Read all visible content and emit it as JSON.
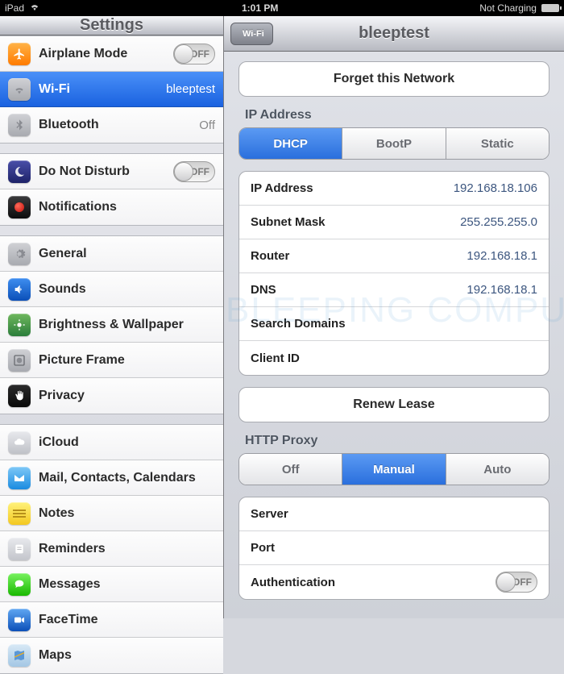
{
  "status": {
    "device": "iPad",
    "time": "1:01 PM",
    "charge": "Not Charging"
  },
  "sidebar": {
    "title": "Settings",
    "groups": [
      [
        {
          "label": "Airplane Mode",
          "toggle": "OFF"
        },
        {
          "label": "Wi-Fi",
          "value": "bleeptest",
          "selected": true
        },
        {
          "label": "Bluetooth",
          "value": "Off"
        }
      ],
      [
        {
          "label": "Do Not Disturb",
          "toggle": "OFF"
        },
        {
          "label": "Notifications"
        }
      ],
      [
        {
          "label": "General"
        },
        {
          "label": "Sounds"
        },
        {
          "label": "Brightness & Wallpaper"
        },
        {
          "label": "Picture Frame"
        },
        {
          "label": "Privacy"
        }
      ],
      [
        {
          "label": "iCloud"
        },
        {
          "label": "Mail, Contacts, Calendars"
        },
        {
          "label": "Notes"
        },
        {
          "label": "Reminders"
        },
        {
          "label": "Messages"
        },
        {
          "label": "FaceTime"
        },
        {
          "label": "Maps"
        }
      ]
    ]
  },
  "detail": {
    "back": "Wi-Fi",
    "title": "bleeptest",
    "forget": "Forget this Network",
    "ip_section": "IP Address",
    "ip_seg": {
      "dhcp": "DHCP",
      "bootp": "BootP",
      "static": "Static"
    },
    "fields": {
      "ip_label": "IP Address",
      "ip_value": "192.168.18.106",
      "mask_label": "Subnet Mask",
      "mask_value": "255.255.255.0",
      "router_label": "Router",
      "router_value": "192.168.18.1",
      "dns_label": "DNS",
      "dns_value": "192.168.18.1",
      "search_label": "Search Domains",
      "client_label": "Client ID"
    },
    "renew": "Renew Lease",
    "proxy_section": "HTTP Proxy",
    "proxy_seg": {
      "off": "Off",
      "manual": "Manual",
      "auto": "Auto"
    },
    "proxy_fields": {
      "server": "Server",
      "port": "Port",
      "auth": "Authentication",
      "auth_toggle": "OFF"
    }
  }
}
